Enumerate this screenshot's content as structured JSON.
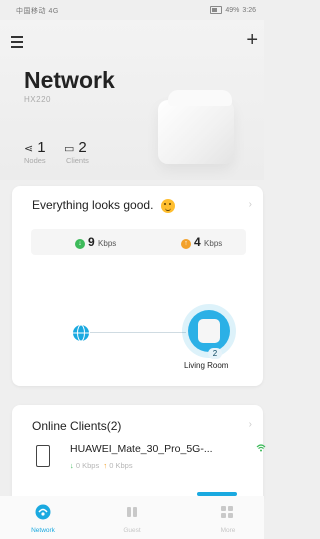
{
  "statusbar": {
    "left": "中国移动 4G",
    "battery": "49%",
    "time": "3:26"
  },
  "header": {
    "title": "Network",
    "model": "HX220"
  },
  "stats": {
    "nodes_count": "1",
    "nodes_label": "Nodes",
    "clients_count": "2",
    "clients_label": "Clients"
  },
  "status_card": {
    "message": "Everything looks good.",
    "download_value": "9",
    "download_unit": "Kbps",
    "upload_value": "4",
    "upload_unit": "Kbps"
  },
  "topology": {
    "node_badge": "2",
    "node_label": "Living Room"
  },
  "clients_card": {
    "title": "Online Clients(2)",
    "client_name": "HUAWEI_Mate_30_Pro_5G-...",
    "client_down": "0 Kbps",
    "client_up": "0 Kbps"
  },
  "tabs": [
    {
      "label": "Network"
    },
    {
      "label": "Guest"
    },
    {
      "label": "More"
    }
  ],
  "colors": {
    "accent": "#1aa9e0",
    "download": "#3dba5a",
    "upload": "#f3a12a"
  }
}
